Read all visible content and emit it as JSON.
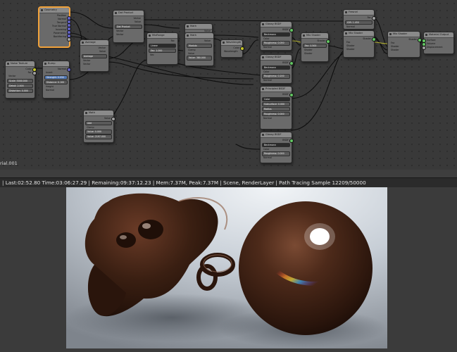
{
  "node_editor": {
    "material_name": "rial.001",
    "nodes": {
      "geometry": {
        "title": "Geometry",
        "rows": [
          "Position",
          "Normal",
          "Tangent",
          "True Normal",
          "Incoming",
          "Parametric",
          "Backfacing"
        ]
      },
      "noise_texture": {
        "title": "Noise Texture",
        "rows": [
          "Color",
          "Fac"
        ],
        "fields": [
          "Vector",
          "Scale: 5000.000",
          "Detail: 2.000",
          "Distortion: 0.000"
        ]
      },
      "bump": {
        "title": "Bump",
        "rows": [
          "Normal"
        ],
        "fields": [
          "Invert",
          "Strength: 0.050",
          "Distance: 0.100",
          "Height",
          "Normal"
        ]
      },
      "average": {
        "title": "Average",
        "rows": [
          "Vector",
          "Value"
        ],
        "fields": [
          "Average",
          "Vector",
          "Vector"
        ]
      },
      "dot_product": {
        "title": "Dot Product",
        "rows": [
          "Vector",
          "Value"
        ],
        "fields": [
          "Dot Product",
          "Vector",
          "Vector"
        ]
      },
      "mapping_range": {
        "title": "MixRange",
        "rows": [
          "Fac"
        ],
        "fields": [
          "Linear",
          "Fac: 1.000",
          "Vec"
        ]
      },
      "math_small": {
        "title": "Math",
        "rows": [
          "Value"
        ]
      },
      "wavelength_math": {
        "title": "Math",
        "rows": [
          "Value"
        ],
        "fields": [
          "Modulo",
          "Clamp",
          "Value",
          "Value: 380.000"
        ]
      },
      "wavelength": {
        "title": "Wavelength",
        "rows": [
          "Color"
        ],
        "fields": [
          "Wavelength"
        ]
      },
      "glossy1": {
        "title": "Glossy BSDF",
        "rows": [
          "BSDF"
        ],
        "fields": [
          "Beckmann",
          "Color",
          "Roughness: 0.050",
          "Normal"
        ]
      },
      "glossy2": {
        "title": "Glossy BSDF",
        "rows": [
          "BSDF"
        ],
        "fields": [
          "Beckmann",
          "Color",
          "Roughness: 0.200",
          "Normal"
        ]
      },
      "translucent": {
        "title": "Principled BSDF",
        "rows": [
          "BSDF"
        ],
        "fields": [
          "Color",
          "Subsurface: 0.000",
          "Radius",
          "Roughness: 0.000",
          "Normal"
        ]
      },
      "glossy3": {
        "title": "Glossy BSDF",
        "rows": [
          "BSDF"
        ],
        "fields": [
          "Beckmann",
          "Color",
          "Roughness: 0.000",
          "Normal"
        ]
      },
      "mix1": {
        "title": "Mix Shader",
        "rows": [
          "Shader"
        ],
        "fields": [
          "Fac: 0.500",
          "Shader",
          "Shader"
        ]
      },
      "fresnel": {
        "title": "Fresnel",
        "rows": [
          "Fac"
        ],
        "fields": [
          "IOR: 1.450",
          "Normal"
        ]
      },
      "mix2": {
        "title": "Mix Shader",
        "rows": [
          "Shader"
        ],
        "fields": [
          "Fac",
          "Shader",
          "Shader"
        ]
      },
      "mix3": {
        "title": "Mix Shader",
        "rows": [
          "Shader"
        ],
        "fields": [
          "Fac",
          "Shader",
          "Shader"
        ]
      },
      "material_output": {
        "title": "Material Output",
        "rows": [
          "Surface",
          "Volume",
          "Displacement"
        ]
      },
      "add_math": {
        "title": "Math",
        "rows": [
          "Value"
        ],
        "fields": [
          "Add",
          "Clamp",
          "Value: 0.000",
          "Value: 2197.000"
        ]
      }
    }
  },
  "status_bar": {
    "text": "| Last:02:52.80 Time:03:06:27.29 | Remaining:09:37:12.23 | Mem:7.37M, Peak:7.37M | Scene, RenderLayer | Path Tracing Sample 12209/50000"
  },
  "render": {
    "subject": "Render of a glossy brown monkey head and sphere"
  }
}
